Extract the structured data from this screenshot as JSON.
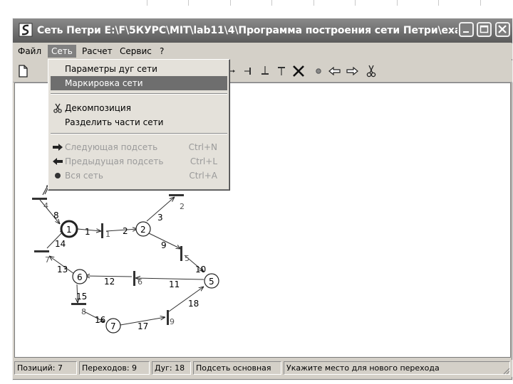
{
  "window": {
    "title": "Сеть Петри E:\\F\\5КУРС\\MIT\\lab11\\4\\Программа построения сети Петри\\exa..."
  },
  "menubar": {
    "items": [
      "Файл",
      "Сеть",
      "Расчет",
      "Сервис",
      "?"
    ],
    "active": "Сеть"
  },
  "dropdown": {
    "items": [
      {
        "label": "Параметры дуг сети",
        "shortcut": "",
        "icon": "",
        "enabled": true,
        "highlighted": false
      },
      {
        "label": "Маркировка сети",
        "shortcut": "",
        "icon": "",
        "enabled": true,
        "highlighted": true
      },
      {
        "label": "Декомпозиция",
        "shortcut": "",
        "icon": "scissors-icon",
        "enabled": true,
        "highlighted": false
      },
      {
        "label": "Разделить части сети",
        "shortcut": "",
        "icon": "",
        "enabled": true,
        "highlighted": false
      },
      {
        "label": "Следующая подсеть",
        "shortcut": "Ctrl+N",
        "icon": "arrow-right-icon",
        "enabled": false,
        "highlighted": false
      },
      {
        "label": "Предыдущая подсеть",
        "shortcut": "Ctrl+L",
        "icon": "arrow-left-icon",
        "enabled": false,
        "highlighted": false
      },
      {
        "label": "Вся сеть",
        "shortcut": "Ctrl+A",
        "icon": "dot-icon",
        "enabled": false,
        "highlighted": false
      }
    ]
  },
  "toolbar": {
    "icons": [
      "new-file-icon",
      "arrow-tool-icon",
      "transition-left-icon",
      "transition-down-icon",
      "transition-up-icon",
      "delete-x-icon",
      "token-icon",
      "arrow-left-icon",
      "arrow-right-icon",
      "scissors-icon"
    ]
  },
  "net": {
    "places": [
      {
        "id": "1",
        "label": "1",
        "highlighted": true
      },
      {
        "id": "2",
        "label": "2"
      },
      {
        "id": "5",
        "label": "5"
      },
      {
        "id": "6",
        "label": "6"
      },
      {
        "id": "7",
        "label": "7"
      }
    ],
    "transitions": [
      "1",
      "2",
      "4",
      "5",
      "6",
      "7",
      "8",
      "9"
    ],
    "arc_labels": [
      "1",
      "2",
      "3",
      "8",
      "9",
      "10",
      "11",
      "12",
      "13",
      "14",
      "15",
      "16",
      "17",
      "18"
    ]
  },
  "status": {
    "positions": "Позиций: 7",
    "transitions": "Переходов: 9",
    "arcs": "Дуг: 18",
    "subnet": "Подсеть основная",
    "hint": "Укажите место для нового перехода"
  }
}
